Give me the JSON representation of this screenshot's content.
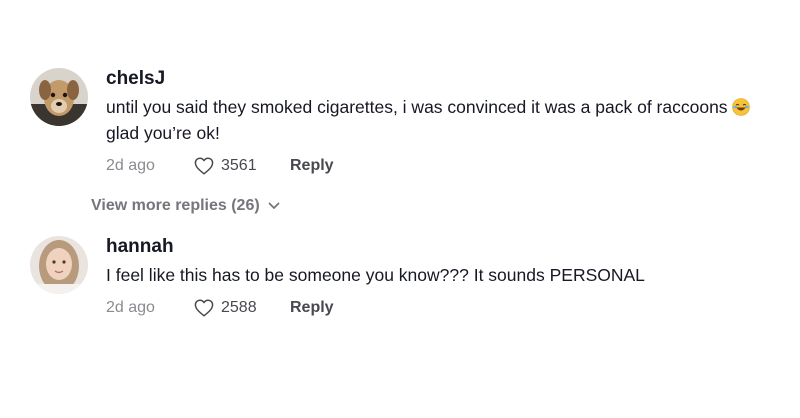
{
  "comments": [
    {
      "username": "chelsJ",
      "text_before_emoji": "until you said they smoked cigarettes, i was convinced it was a pack of raccoons",
      "emoji": "face-with-tears-of-joy",
      "text_after_emoji": "glad you’re ok!",
      "date": "2d ago",
      "likes": "3561",
      "reply_label": "Reply",
      "avatar": "dog-avatar"
    },
    {
      "username": "hannah",
      "text": "I feel like this has to be someone you know??? It sounds PERSONAL",
      "date": "2d ago",
      "likes": "2588",
      "reply_label": "Reply",
      "avatar": "person-avatar"
    }
  ],
  "view_more_replies": "View more replies (26)",
  "colors": {
    "primary_text": "#161823",
    "secondary_text": "#8a8b91",
    "link_text": "#75767c"
  }
}
